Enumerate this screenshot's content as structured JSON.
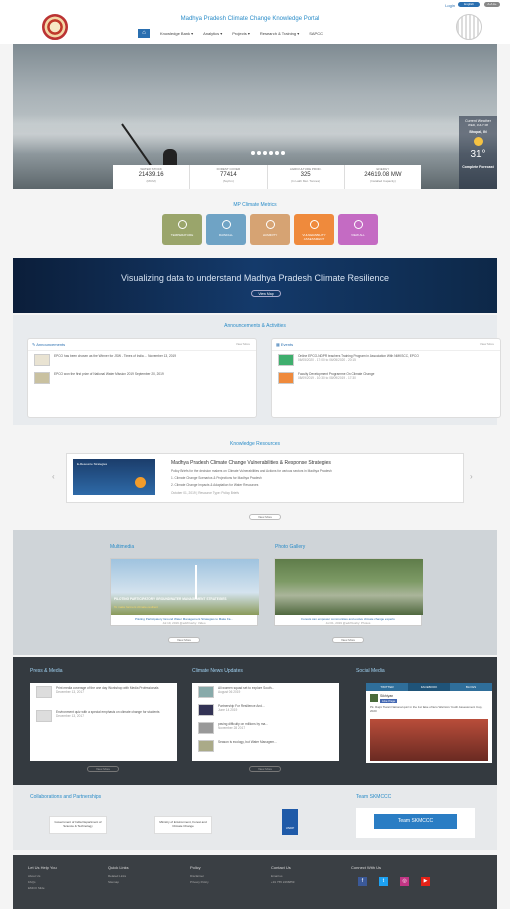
{
  "top": {
    "login": "Login",
    "language": "English",
    "accessibility": "A-A A+"
  },
  "header": {
    "title": "Madhya Pradesh Climate Change Knowledge Portal"
  },
  "nav": {
    "home_icon": "home-icon",
    "items": [
      "Knowledge Bank ▾",
      "Analytics ▾",
      "Projects ▾",
      "Research & Training ▾",
      "SAPCC"
    ]
  },
  "hero": {
    "stats": [
      {
        "label": "WATER STOCK",
        "value": "21439.16",
        "sub": "(MCM)"
      },
      {
        "label": "FOREST COVER",
        "value": "77414",
        "sub": "(Sq.Km)"
      },
      {
        "label": "AGRICULTURE PROD.",
        "value": "325",
        "sub": "(In Lakh Met. Tonnes)"
      },
      {
        "label": "ENERGY",
        "value": "24619.08 MW",
        "sub": "(Installed Capacity)"
      }
    ],
    "weather": {
      "title": "Current Weather",
      "date": "WED, JULY 08",
      "city": "Bhopal, IN",
      "temp": "31°",
      "forecast": "Complete Forecast"
    }
  },
  "metrics": {
    "title": "MP Climate Metrics",
    "items": [
      {
        "label": "TEMPERATURE",
        "color": "#9aa56b"
      },
      {
        "label": "RAINFALL",
        "color": "#6fa3c5"
      },
      {
        "label": "HUMIDITY",
        "color": "#d6a373"
      },
      {
        "label": "VULNERABILITY ASSESSMENT",
        "color": "#ef8a3c"
      },
      {
        "label": "VIEW ALL",
        "color": "#c46bc3"
      }
    ]
  },
  "banner": {
    "text": "Visualizing data to understand Madhya Pradesh Climate Resilience",
    "button": "View Map"
  },
  "announcements": {
    "section_title": "Announcements & Activities",
    "panel_title": "Announcements",
    "view_more": "View More",
    "items": [
      "EPCO has been chosen as the Winner for JSW - Times of India ... November 13, 2019",
      "EPCO won the first prize of National Water Mission 2019  September 20, 2019"
    ]
  },
  "events": {
    "panel_title": "Events",
    "view_more": "View More",
    "items": [
      {
        "title": "Online EPCO-NDPR teachers Training Program in Association With NMKSCC, EPCO",
        "date": "06/05/2020 - 17:00 to 06/05/2020 - 20:15"
      },
      {
        "title": "Faculty Development Programme On Climate Change",
        "date": "08/09/2019 - 10:30 to 08/09/2019 - 17:30"
      }
    ]
  },
  "knowledge": {
    "section_title": "Knowledge Resources",
    "image_label": "E-Resource Strategies",
    "title": "Madhya Pradesh Climate Change Vulnerabilities & Response Strategies",
    "desc": "Policy Briefs for the decision makers on Climate Vulnerabilities and Actions for various sectors in Madhya Pradesh",
    "points": [
      "1. Climate Change Scenarios & Projections for Madhya Pradesh",
      "2. Climate Change Impacts & Adaptation for Water Resources"
    ],
    "meta": "October 01, 2019 | Resource Type: Policy Briefs",
    "button": "View More",
    "prev": "‹",
    "next": "›"
  },
  "multimedia": {
    "title": "Multimedia",
    "caption": "Piloting Participatory Ground Water Management Strategies to Make Fa...",
    "date": "Jul 19, 2019  @edzhlushy: Video",
    "overlay": "PILOTING PARTICIPATORY GROUNDWATER MANAGEMENT STRATEGIES",
    "overlay2": "To make farmers climate-resilient",
    "button": "View More"
  },
  "gallery": {
    "title": "Photo Gallery",
    "caption": "Forests can empower communities and evolve climate change experts",
    "date": "Jul 01, 2019  @edzhlushy: Photos",
    "button": "View More"
  },
  "press": {
    "title": "Press & Media",
    "items": [
      {
        "text": "Print media coverage of the one day Workshop with Media Professionals",
        "date": "December 13, 2017"
      },
      {
        "text": "Environment quiz with a special emphasis on climate change for students",
        "date": "December 13, 2017"
      }
    ],
    "button": "View More"
  },
  "news": {
    "title": "Climate News Updates",
    "items": [
      {
        "text": "Ali women squad set to explore South...",
        "date": "August 06 2019"
      },
      {
        "text": "Partnership For Resilience And...",
        "date": "June 14 2019"
      },
      {
        "text": "paving difficulty on millions by ma...",
        "date": "November 28 2017"
      },
      {
        "text": "Season is ecology, but Water Managem...",
        "date": ""
      }
    ],
    "button": "View More"
  },
  "social": {
    "title": "Social Media",
    "tabs": [
      "TWITTER",
      "FACEBOOK",
      "BLOGS"
    ],
    "page_name": "Sikhiyan",
    "like": "Like Page",
    "post": "Pk. Rajni Tiwari National quiz in the 1st fake of Eco Warriors Youth Assessment Cup, 2020"
  },
  "collab": {
    "title": "Collaborations and Partnerships",
    "logos": [
      "Government of India Department of Science & Technology",
      "Ministry of Environment, Forest and Climate Change",
      "UNDP"
    ],
    "team_title": "Team SKMCCC",
    "team_button": "Team SKMCCC"
  },
  "footer": {
    "cols": [
      {
        "head": "Let Us Help You",
        "items": [
          "About Us",
          "FAQs",
          "EMCO Slide"
        ]
      },
      {
        "head": "Quick Links",
        "items": [
          "Related Links",
          "Sitemap"
        ]
      },
      {
        "head": "Policy",
        "items": [
          "Disclaimer",
          "Privacy Policy"
        ]
      },
      {
        "head": "Contact Us",
        "items": [
          "Email us",
          "+91 755 2466859"
        ]
      }
    ],
    "connect": "Connect With Us",
    "social": [
      {
        "icon": "facebook-icon",
        "glyph": "f",
        "color": "#3b5998"
      },
      {
        "icon": "twitter-icon",
        "glyph": "t",
        "color": "#1da1f2"
      },
      {
        "icon": "instagram-icon",
        "glyph": "◎",
        "color": "#c13584"
      },
      {
        "icon": "youtube-icon",
        "glyph": "▶",
        "color": "#e62117"
      }
    ]
  }
}
